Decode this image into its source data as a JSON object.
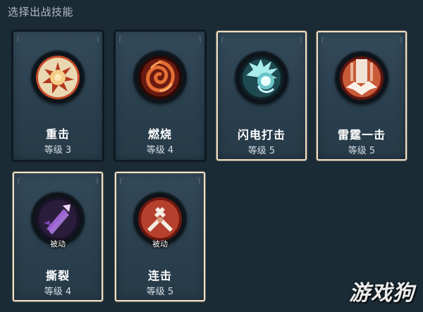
{
  "header": {
    "title": "选择出战技能"
  },
  "skills": [
    {
      "name": "重击",
      "level": "等级 3",
      "selected": false,
      "passive_label": "",
      "icon": "heavy-strike-icon",
      "colors": {
        "outer": "#f3e3c1",
        "inner": "#b33a1f",
        "core": "#f7c97b"
      }
    },
    {
      "name": "燃烧",
      "level": "等级 4",
      "selected": false,
      "passive_label": "",
      "icon": "burn-icon",
      "colors": {
        "outer": "#7a1d12",
        "inner": "#d5582c",
        "core": "#ffb069"
      }
    },
    {
      "name": "闪电打击",
      "level": "等级 5",
      "selected": true,
      "passive_label": "",
      "icon": "lightning-strike-icon",
      "colors": {
        "outer": "#19363e",
        "inner": "#8ad8d6",
        "core": "#e8fbfb"
      }
    },
    {
      "name": "雷霆一击",
      "level": "等级 5",
      "selected": true,
      "passive_label": "",
      "icon": "thunder-strike-icon",
      "colors": {
        "outer": "#7a2418",
        "inner": "#d46741",
        "core": "#f4e8dd"
      }
    },
    {
      "name": "撕裂",
      "level": "等级 4",
      "selected": true,
      "passive_label": "被动",
      "icon": "tear-icon",
      "colors": {
        "outer": "#2d1b3e",
        "inner": "#8a52be",
        "core": "#d7b4ff"
      }
    },
    {
      "name": "连击",
      "level": "等级 5",
      "selected": true,
      "passive_label": "被动",
      "icon": "combo-icon",
      "colors": {
        "outer": "#8c2418",
        "inner": "#c74e35",
        "core": "#efe6d8"
      }
    }
  ],
  "watermark": "游戏狗"
}
